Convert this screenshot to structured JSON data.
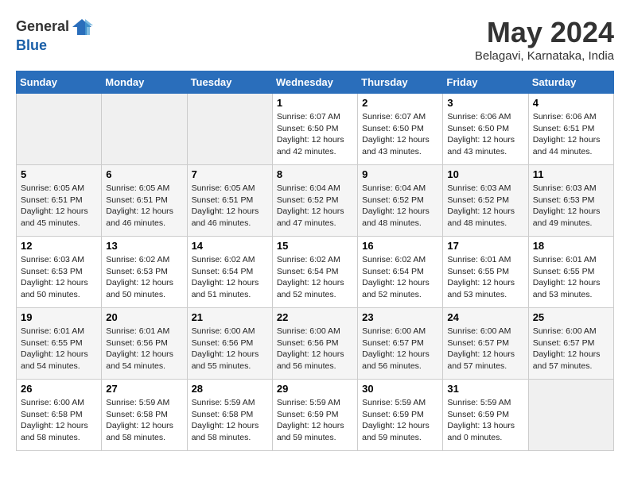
{
  "logo": {
    "text_general": "General",
    "text_blue": "Blue"
  },
  "title": {
    "month_year": "May 2024",
    "location": "Belagavi, Karnataka, India"
  },
  "headers": [
    "Sunday",
    "Monday",
    "Tuesday",
    "Wednesday",
    "Thursday",
    "Friday",
    "Saturday"
  ],
  "weeks": [
    [
      {
        "day": "",
        "info": ""
      },
      {
        "day": "",
        "info": ""
      },
      {
        "day": "",
        "info": ""
      },
      {
        "day": "1",
        "info": "Sunrise: 6:07 AM\nSunset: 6:50 PM\nDaylight: 12 hours\nand 42 minutes."
      },
      {
        "day": "2",
        "info": "Sunrise: 6:07 AM\nSunset: 6:50 PM\nDaylight: 12 hours\nand 43 minutes."
      },
      {
        "day": "3",
        "info": "Sunrise: 6:06 AM\nSunset: 6:50 PM\nDaylight: 12 hours\nand 43 minutes."
      },
      {
        "day": "4",
        "info": "Sunrise: 6:06 AM\nSunset: 6:51 PM\nDaylight: 12 hours\nand 44 minutes."
      }
    ],
    [
      {
        "day": "5",
        "info": "Sunrise: 6:05 AM\nSunset: 6:51 PM\nDaylight: 12 hours\nand 45 minutes."
      },
      {
        "day": "6",
        "info": "Sunrise: 6:05 AM\nSunset: 6:51 PM\nDaylight: 12 hours\nand 46 minutes."
      },
      {
        "day": "7",
        "info": "Sunrise: 6:05 AM\nSunset: 6:51 PM\nDaylight: 12 hours\nand 46 minutes."
      },
      {
        "day": "8",
        "info": "Sunrise: 6:04 AM\nSunset: 6:52 PM\nDaylight: 12 hours\nand 47 minutes."
      },
      {
        "day": "9",
        "info": "Sunrise: 6:04 AM\nSunset: 6:52 PM\nDaylight: 12 hours\nand 48 minutes."
      },
      {
        "day": "10",
        "info": "Sunrise: 6:03 AM\nSunset: 6:52 PM\nDaylight: 12 hours\nand 48 minutes."
      },
      {
        "day": "11",
        "info": "Sunrise: 6:03 AM\nSunset: 6:53 PM\nDaylight: 12 hours\nand 49 minutes."
      }
    ],
    [
      {
        "day": "12",
        "info": "Sunrise: 6:03 AM\nSunset: 6:53 PM\nDaylight: 12 hours\nand 50 minutes."
      },
      {
        "day": "13",
        "info": "Sunrise: 6:02 AM\nSunset: 6:53 PM\nDaylight: 12 hours\nand 50 minutes."
      },
      {
        "day": "14",
        "info": "Sunrise: 6:02 AM\nSunset: 6:54 PM\nDaylight: 12 hours\nand 51 minutes."
      },
      {
        "day": "15",
        "info": "Sunrise: 6:02 AM\nSunset: 6:54 PM\nDaylight: 12 hours\nand 52 minutes."
      },
      {
        "day": "16",
        "info": "Sunrise: 6:02 AM\nSunset: 6:54 PM\nDaylight: 12 hours\nand 52 minutes."
      },
      {
        "day": "17",
        "info": "Sunrise: 6:01 AM\nSunset: 6:55 PM\nDaylight: 12 hours\nand 53 minutes."
      },
      {
        "day": "18",
        "info": "Sunrise: 6:01 AM\nSunset: 6:55 PM\nDaylight: 12 hours\nand 53 minutes."
      }
    ],
    [
      {
        "day": "19",
        "info": "Sunrise: 6:01 AM\nSunset: 6:55 PM\nDaylight: 12 hours\nand 54 minutes."
      },
      {
        "day": "20",
        "info": "Sunrise: 6:01 AM\nSunset: 6:56 PM\nDaylight: 12 hours\nand 54 minutes."
      },
      {
        "day": "21",
        "info": "Sunrise: 6:00 AM\nSunset: 6:56 PM\nDaylight: 12 hours\nand 55 minutes."
      },
      {
        "day": "22",
        "info": "Sunrise: 6:00 AM\nSunset: 6:56 PM\nDaylight: 12 hours\nand 56 minutes."
      },
      {
        "day": "23",
        "info": "Sunrise: 6:00 AM\nSunset: 6:57 PM\nDaylight: 12 hours\nand 56 minutes."
      },
      {
        "day": "24",
        "info": "Sunrise: 6:00 AM\nSunset: 6:57 PM\nDaylight: 12 hours\nand 57 minutes."
      },
      {
        "day": "25",
        "info": "Sunrise: 6:00 AM\nSunset: 6:57 PM\nDaylight: 12 hours\nand 57 minutes."
      }
    ],
    [
      {
        "day": "26",
        "info": "Sunrise: 6:00 AM\nSunset: 6:58 PM\nDaylight: 12 hours\nand 58 minutes."
      },
      {
        "day": "27",
        "info": "Sunrise: 5:59 AM\nSunset: 6:58 PM\nDaylight: 12 hours\nand 58 minutes."
      },
      {
        "day": "28",
        "info": "Sunrise: 5:59 AM\nSunset: 6:58 PM\nDaylight: 12 hours\nand 58 minutes."
      },
      {
        "day": "29",
        "info": "Sunrise: 5:59 AM\nSunset: 6:59 PM\nDaylight: 12 hours\nand 59 minutes."
      },
      {
        "day": "30",
        "info": "Sunrise: 5:59 AM\nSunset: 6:59 PM\nDaylight: 12 hours\nand 59 minutes."
      },
      {
        "day": "31",
        "info": "Sunrise: 5:59 AM\nSunset: 6:59 PM\nDaylight: 13 hours\nand 0 minutes."
      },
      {
        "day": "",
        "info": ""
      }
    ]
  ]
}
